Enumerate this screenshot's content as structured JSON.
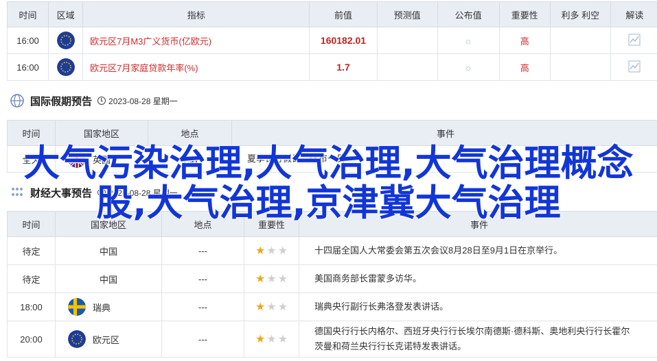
{
  "indicators": {
    "headers": [
      "时间",
      "区域",
      "指标",
      "前值",
      "预测值",
      "公布值",
      "重要性",
      "利多 利空",
      "解读"
    ],
    "rows": [
      {
        "time": "16:00",
        "region_flag": "eu-flag-icon",
        "name": "欧元区7月M3广义货币(亿欧元)",
        "prev": "160182.01",
        "importance": "高"
      },
      {
        "time": "16:00",
        "region_flag": "eu-flag-icon",
        "name": "欧元区7月家庭贷款年率(%)",
        "prev": "1.7",
        "importance": "高"
      }
    ]
  },
  "holiday": {
    "title": "国际假期预告",
    "date": "2023-08-28 星期一",
    "headers": [
      "时间",
      "国家地区",
      "地点",
      "事件"
    ],
    "rows": [
      {
        "time": "全天",
        "region_flag": "uk-flag-icon",
        "region": "英国",
        "place": "伦敦",
        "event": "夏季银行假日，休市一日"
      }
    ]
  },
  "finance": {
    "title": "财经大事预告",
    "date": "2023-08-28 星期一",
    "headers": [
      "时间",
      "国家地区",
      "地点",
      "重要性",
      "事件"
    ],
    "rows": [
      {
        "time": "待定",
        "region": "中国",
        "place": "---",
        "stars": 1,
        "event": "十四届全国人大常委会第五次会议8月28日至9月1日在京举行。"
      },
      {
        "time": "待定",
        "region": "中国",
        "place": "---",
        "stars": 1,
        "event": "美国商务部长雷蒙多访华。"
      },
      {
        "time": "18:00",
        "region_flag": "sweden-flag-icon",
        "region": "瑞典",
        "place": "---",
        "stars": 1,
        "event": "瑞典央行副行长弗洛登发表讲话。"
      },
      {
        "time": "20:00",
        "region_flag": "eu-flag-icon",
        "region": "欧元区",
        "place": "---",
        "stars": 1,
        "event_line1": "德国央行行长内格尔、西班牙央行行长埃尔南德斯·德科斯、奥地利央行行长霍尔",
        "event_line2": "茨曼和荷兰央行行长克诺特发表讲话。"
      }
    ]
  },
  "overlay_text": "大气污染治理,大气治理,大气治理概念股,大气治理,京津冀大气治理",
  "colors": {
    "accent_red": "#c81f1f",
    "header_bg": "#e9edf4",
    "overlay_blue": "#1236d6",
    "star": "#f0a61b"
  }
}
